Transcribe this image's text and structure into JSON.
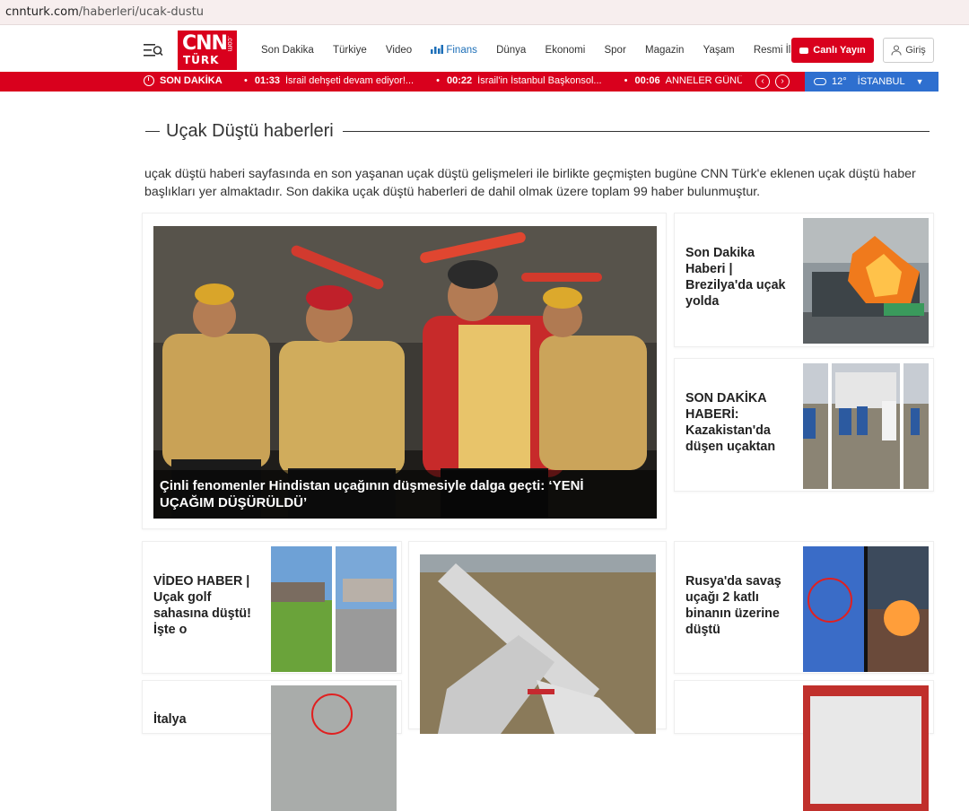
{
  "browser": {
    "url_host": "cnnturk.com",
    "url_path": "/haberleri/ucak-dustu"
  },
  "header": {
    "logo": {
      "line1": "CNN",
      "line2": "TÜRK",
      "suffix": ".com"
    },
    "nav": [
      {
        "label": "Son Dakika"
      },
      {
        "label": "Türkiye"
      },
      {
        "label": "Video"
      },
      {
        "label": "Finans",
        "icon": "chart-bars-icon"
      },
      {
        "label": "Dünya"
      },
      {
        "label": "Ekonomi"
      },
      {
        "label": "Spor"
      },
      {
        "label": "Magazin"
      },
      {
        "label": "Yaşam"
      },
      {
        "label": "Resmi İlanlar"
      }
    ],
    "live_label": "Canlı Yayın",
    "login_label": "Giriş"
  },
  "breaking": {
    "label": "SON DAKİKA",
    "items": [
      {
        "time": "01:33",
        "text": "İsrail dehşeti devam ediyor!..."
      },
      {
        "time": "00:22",
        "text": "İsrail'in İstanbul Başkonsol..."
      },
      {
        "time": "00:06",
        "text": "ANNELER GÜNÜ MESAJLARI"
      }
    ]
  },
  "weather": {
    "temp": "12°",
    "city": "İSTANBUL"
  },
  "page": {
    "title": "Uçak Düştü haberleri",
    "intro": "uçak düştü haberi sayfasında en son yaşanan uçak düştü gelişmeleri ile birlikte geçmişten bugüne CNN Türk'e eklenen uçak düştü haber başlıkları yer almaktadır. Son dakika uçak düştü haberleri de dahil olmak üzere toplam 99 haber bulunmuştur."
  },
  "articles": {
    "hero": {
      "title": "Çinli fenomenler Hindistan uçağının düşmesiyle dalga geçti: ‘YENİ UÇAĞIM DÜŞÜRÜLDÜ’"
    },
    "side1": {
      "title": "Son Dakika Haberi | Brezilya'da uçak yolda"
    },
    "side2": {
      "title": "SON DAKİKA HABERİ: Kazakistan'da düşen uçaktan"
    },
    "row1": {
      "title": "VİDEO HABER | Uçak golf sahasına düştü! İşte o"
    },
    "row3": {
      "title": "Rusya'da savaş uçağı 2 katlı binanın üzerine düştü"
    },
    "row4": {
      "title": "İtalya"
    }
  },
  "colors": {
    "brand_red": "#d9001d",
    "weather_blue": "#2e6fcf",
    "finance_blue": "#1d6fb8"
  }
}
